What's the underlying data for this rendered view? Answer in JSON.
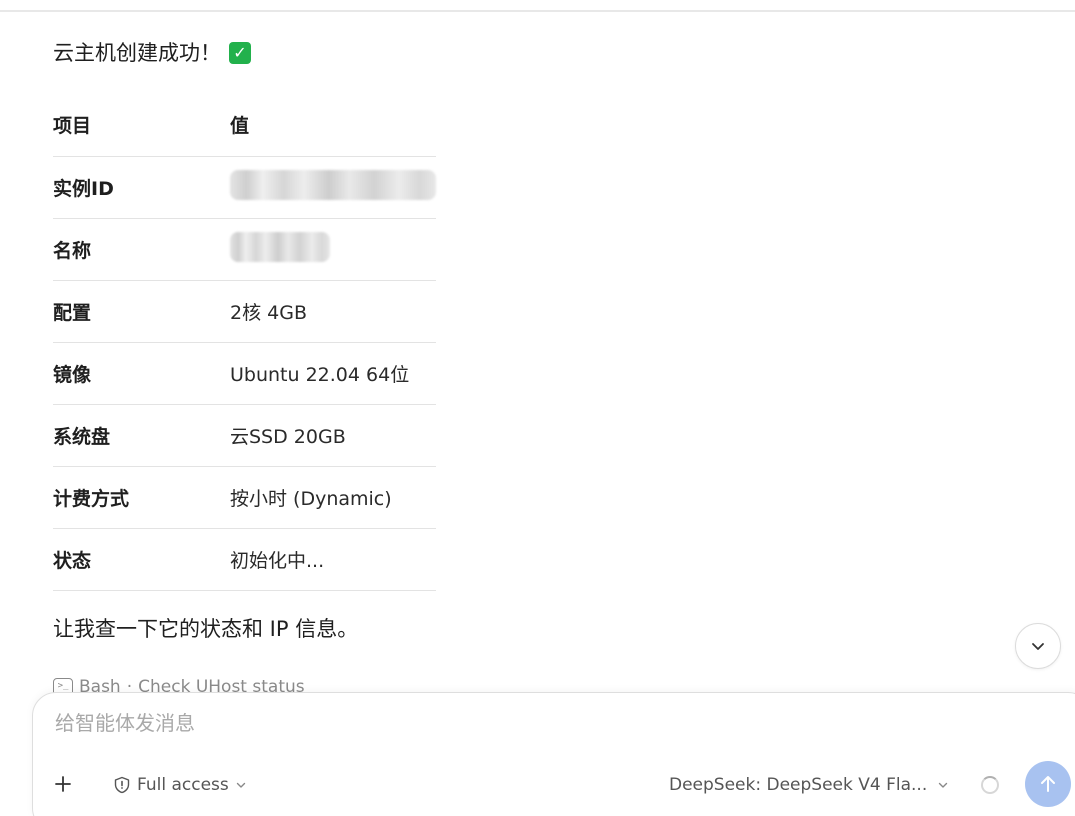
{
  "message": {
    "intro_text": "云主机创建成功！",
    "check_emoji": "✅",
    "table": {
      "headers": [
        "项目",
        "值"
      ],
      "rows": [
        {
          "key": "实例ID",
          "value": "",
          "redacted": true
        },
        {
          "key": "名称",
          "value": "",
          "redacted": true
        },
        {
          "key": "配置",
          "value": "2核 4GB"
        },
        {
          "key": "镜像",
          "value": "Ubuntu 22.04 64位"
        },
        {
          "key": "系统盘",
          "value": "云SSD 20GB"
        },
        {
          "key": "计费方式",
          "value": "按小时 (Dynamic)"
        },
        {
          "key": "状态",
          "value": "初始化中..."
        }
      ]
    },
    "followup_text": "让我查一下它的状态和 IP 信息。",
    "tool_call": {
      "icon": "terminal-icon",
      "tool": "Bash",
      "separator": "·",
      "description": "Check UHost status"
    }
  },
  "composer": {
    "placeholder": "给智能体发消息",
    "add_icon": "plus-icon",
    "access_label": "Full access",
    "access_icon": "shield-icon",
    "model_label": "DeepSeek: DeepSeek V4 Fla...",
    "send_icon": "arrow-up-icon"
  },
  "colors": {
    "send_button": "#a8c2f0",
    "divider": "#e3e3e3",
    "check_badge": "#22b14c"
  }
}
